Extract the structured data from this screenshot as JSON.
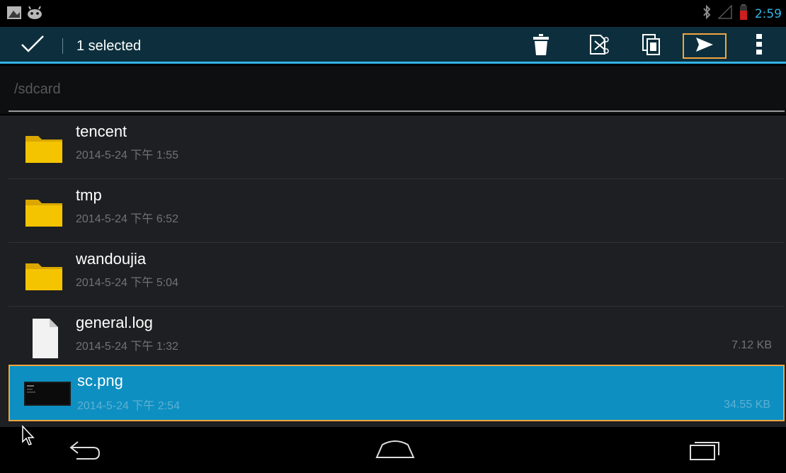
{
  "status": {
    "time": "2:59",
    "icons": [
      "gallery-notification-icon",
      "android-notification-icon",
      "bluetooth-icon",
      "signal-icon",
      "battery-low-icon"
    ]
  },
  "action_bar": {
    "title": "1 selected",
    "actions": [
      "done-check-icon",
      "delete-icon",
      "cut-icon",
      "copy-icon",
      "send-icon",
      "overflow-menu-icon"
    ]
  },
  "path": {
    "text": "/sdcard"
  },
  "files": [
    {
      "name": "tencent",
      "date": "2014-5-24 下午 1:55",
      "size": "",
      "type": "folder",
      "selected": false
    },
    {
      "name": "tmp",
      "date": "2014-5-24 下午 6:52",
      "size": "",
      "type": "folder",
      "selected": false
    },
    {
      "name": "wandoujia",
      "date": "2014-5-24 下午 5:04",
      "size": "",
      "type": "folder",
      "selected": false
    },
    {
      "name": "general.log",
      "date": "2014-5-24 下午 1:32",
      "size": "7.12 KB",
      "type": "file",
      "selected": false
    },
    {
      "name": "sc.png",
      "date": "2014-5-24 下午 2:54",
      "size": "34.55 KB",
      "type": "image",
      "selected": true
    }
  ],
  "nav": {
    "buttons": [
      "back-icon",
      "home-icon",
      "recent-apps-icon"
    ]
  },
  "colors": {
    "accent": "#33b5e5",
    "selected_row": "#0d8fc1",
    "highlight_border": "#f0a640",
    "folder": "#f5c400"
  }
}
